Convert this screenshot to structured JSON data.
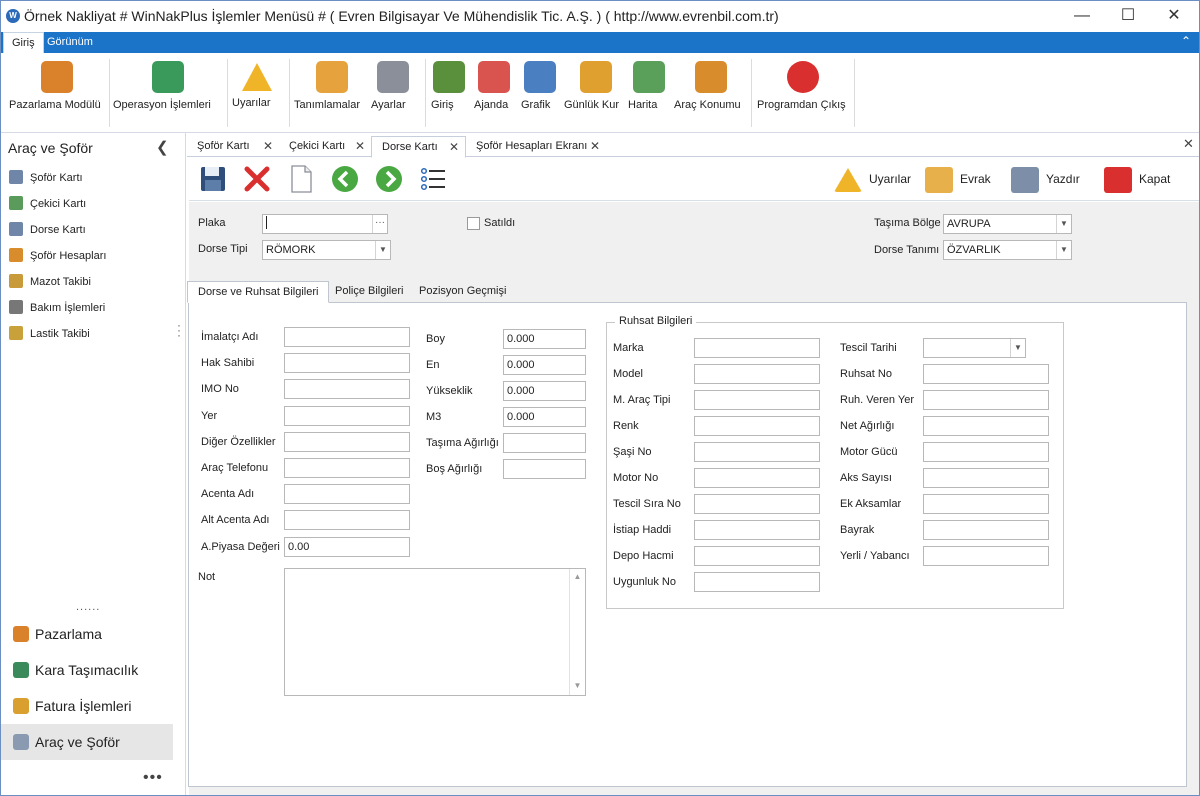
{
  "window": {
    "title": "Örnek Nakliyat # WinNakPlus İşlemler Menüsü #  ( Evren Bilgisayar Ve Mühendislik Tic. A.Ş. ) ( http://www.evrenbil.com.tr)",
    "app_icon_letter": "W"
  },
  "ribbon_tabs": [
    "Giriş",
    "Görünüm"
  ],
  "ribbon": {
    "buttons": [
      {
        "label": "Pazarlama Modülü",
        "icon": "users-icon",
        "color": "#d9822b"
      },
      {
        "label": "Operasyon İşlemleri",
        "icon": "export-icon",
        "color": "#3a9a5b"
      },
      {
        "label": "Uyarılar",
        "icon": "warning-icon",
        "color": "#f0b429"
      },
      {
        "label": "Tanımlamalar",
        "icon": "definitions-icon",
        "color": "#e6a23c"
      },
      {
        "label": "Ayarlar",
        "icon": "gear-icon",
        "color": "#8a8f99"
      },
      {
        "label": "Giriş",
        "icon": "home-icon",
        "color": "#5a8f3c"
      },
      {
        "label": "Ajanda",
        "icon": "calendar-icon",
        "color": "#d9534f"
      },
      {
        "label": "Grafik",
        "icon": "chart-icon",
        "color": "#4a7fc1"
      },
      {
        "label": "Günlük Kur",
        "icon": "currency-icon",
        "color": "#e0a030"
      },
      {
        "label": "Harita",
        "icon": "map-icon",
        "color": "#5aa05a"
      },
      {
        "label": "Araç Konumu",
        "icon": "location-icon",
        "color": "#d98c2b"
      },
      {
        "label": "Programdan Çıkış",
        "icon": "exit-icon",
        "color": "#d9302f"
      }
    ]
  },
  "sidebar": {
    "title": "Araç ve Şoför",
    "items": [
      {
        "label": "Şoför Kartı",
        "icon": "id-card-icon",
        "color": "#6f86a8"
      },
      {
        "label": "Çekici Kartı",
        "icon": "edit-document-icon",
        "color": "#5a9a5a"
      },
      {
        "label": "Dorse Kartı",
        "icon": "edit-document-icon",
        "color": "#6f86a8"
      },
      {
        "label": "Şoför Hesapları",
        "icon": "accounts-icon",
        "color": "#d98c2b"
      },
      {
        "label": "Mazot Takibi",
        "icon": "fuel-icon",
        "color": "#c99a3a"
      },
      {
        "label": "Bakım İşlemleri",
        "icon": "tools-icon",
        "color": "#777777"
      },
      {
        "label": "Lastik Takibi",
        "icon": "checklist-icon",
        "color": "#c9a13a"
      }
    ],
    "dots": "......",
    "groups": [
      {
        "label": "Pazarlama",
        "icon": "users-icon",
        "color": "#d9822b"
      },
      {
        "label": "Kara Taşımacılık",
        "icon": "globe-icon",
        "color": "#3a8a5b"
      },
      {
        "label": "Fatura İşlemleri",
        "icon": "coins-icon",
        "color": "#d9a030"
      },
      {
        "label": "Araç ve Şoför",
        "icon": "document-icon",
        "color": "#8a9ab0"
      }
    ],
    "more": "•••"
  },
  "doc_tabs": [
    {
      "label": "Şoför Kartı",
      "active": false
    },
    {
      "label": "Çekici Kartı",
      "active": false
    },
    {
      "label": "Dorse Kartı",
      "active": true
    },
    {
      "label": "Şoför Hesapları Ekranı",
      "active": false
    }
  ],
  "toolbar": {
    "right": [
      {
        "label": "Uyarılar",
        "icon": "warning-icon",
        "color": "#f0b429"
      },
      {
        "label": "Evrak",
        "icon": "folder-icon",
        "color": "#e8b04a"
      },
      {
        "label": "Yazdır",
        "icon": "printer-icon",
        "color": "#7d8fa8"
      },
      {
        "label": "Kapat",
        "icon": "close-icon",
        "color": "#d9302f"
      }
    ]
  },
  "header_form": {
    "plaka_label": "Plaka",
    "plaka_value": "",
    "dorse_tipi_label": "Dorse Tipi",
    "dorse_tipi_value": "RÖMORK",
    "satildi_label": "Satıldı",
    "tasima_bolge_label": "Taşıma Bölge",
    "tasima_bolge_value": "AVRUPA",
    "dorse_tanimi_label": "Dorse Tanımı",
    "dorse_tanimi_value": "ÖZVARLIK"
  },
  "subtabs": [
    "Dorse ve Ruhsat Bilgileri",
    "Poliçe Bilgileri",
    "Pozisyon Geçmişi"
  ],
  "left_fields": [
    {
      "label": "İmalatçı Adı",
      "value": ""
    },
    {
      "label": "Hak Sahibi",
      "value": ""
    },
    {
      "label": "IMO No",
      "value": ""
    },
    {
      "label": "Yer",
      "value": ""
    },
    {
      "label": "Diğer Özellikler",
      "value": ""
    },
    {
      "label": "Araç Telefonu",
      "value": ""
    },
    {
      "label": "Acenta Adı",
      "value": ""
    },
    {
      "label": "Alt Acenta Adı",
      "value": ""
    },
    {
      "label": "A.Piyasa Değeri",
      "value": "0.00"
    }
  ],
  "mid_fields": [
    {
      "label": "Boy",
      "value": "0.000"
    },
    {
      "label": "En",
      "value": "0.000"
    },
    {
      "label": "Yükseklik",
      "value": "0.000"
    },
    {
      "label": "M3",
      "value": "0.000"
    },
    {
      "label": "Taşıma Ağırlığı",
      "value": ""
    },
    {
      "label": "Boş Ağırlığı",
      "value": ""
    }
  ],
  "not_label": "Not",
  "ruhsat": {
    "title": "Ruhsat Bilgileri",
    "left": [
      {
        "label": "Marka",
        "value": ""
      },
      {
        "label": "Model",
        "value": ""
      },
      {
        "label": "M. Araç Tipi",
        "value": ""
      },
      {
        "label": "Renk",
        "value": ""
      },
      {
        "label": "Şaşi No",
        "value": ""
      },
      {
        "label": "Motor No",
        "value": ""
      },
      {
        "label": "Tescil Sıra No",
        "value": ""
      },
      {
        "label": "İstiap Haddi",
        "value": ""
      },
      {
        "label": "Depo Hacmi",
        "value": ""
      },
      {
        "label": "Uygunluk No",
        "value": ""
      }
    ],
    "right": [
      {
        "label": "Tescil Tarihi",
        "value": ""
      },
      {
        "label": "Ruhsat No",
        "value": ""
      },
      {
        "label": "Ruh. Veren Yer",
        "value": ""
      },
      {
        "label": "Net Ağırlığı",
        "value": ""
      },
      {
        "label": "Motor Gücü",
        "value": ""
      },
      {
        "label": "Aks Sayısı",
        "value": ""
      },
      {
        "label": "Ek Aksamlar",
        "value": ""
      },
      {
        "label": "Bayrak",
        "value": ""
      },
      {
        "label": "Yerli / Yabancı",
        "value": ""
      }
    ]
  }
}
